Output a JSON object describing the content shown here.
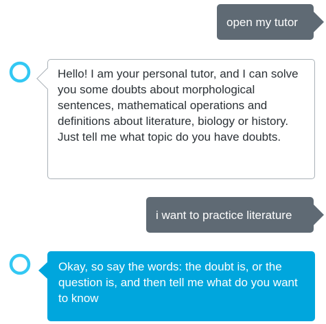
{
  "conversation": {
    "messages": [
      {
        "speaker": "user",
        "text": "open my tutor"
      },
      {
        "speaker": "alexa",
        "icon": "alexa-ring-icon",
        "text": "Hello! I am your personal tutor, and I can solve you some doubts about morphological sentences, mathematical operations and definitions about literature, biology or history. Just tell me what topic do you have doubts."
      },
      {
        "speaker": "user",
        "text": "i want to practice literature"
      },
      {
        "speaker": "alexa",
        "icon": "alexa-ring-icon",
        "text": "Okay, so say the words: the doubt is, or the question is, and then tell me what do you want to know"
      }
    ]
  },
  "colors": {
    "user_bubble": "#5f6a74",
    "alexa_card": "#00a6dd",
    "alexa_border": "#a9b1b7",
    "alexa_ring": "#33c8f3"
  }
}
